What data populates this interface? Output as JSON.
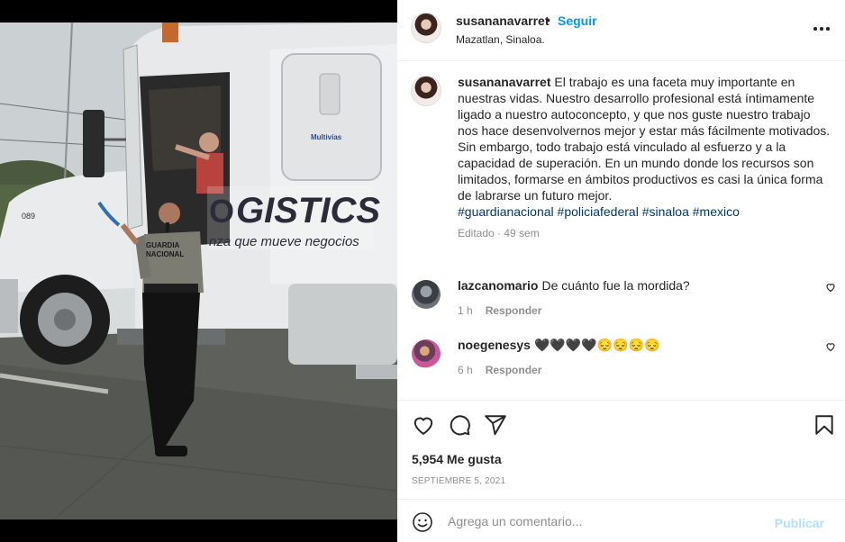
{
  "post": {
    "author": "susananavarret",
    "dot": "•",
    "follow_label": "Seguir",
    "location": "Mazatlan, Sinaloa.",
    "photo_alt": "Oficial de la Guardia Nacional junto a un camión de carga"
  },
  "photo_texts": {
    "logo_line1": "Multivías",
    "logistics": "GISTICS",
    "logistics_prefix": "O",
    "slogan": "nza que mueve negocios",
    "patch_line1": "GUARDIA",
    "patch_line2": "NACIONAL",
    "truck_number": "089"
  },
  "caption": {
    "username": "susananavarret",
    "paragraph1": "El trabajo es una faceta muy importante en nuestras vidas. Nuestro desarrollo profesional está íntimamente ligado a nuestro autoconcepto, y que nos guste nuestro trabajo nos hace desenvolvernos mejor y estar más fácilmente motivados.",
    "paragraph2": "Sin embargo, todo trabajo está vinculado al esfuerzo y a la capacidad de superación. En un mundo donde los recursos son limitados, formarse en ámbitos productivos es casi la única forma de labrarse un futuro mejor.",
    "hashtags": [
      "#guardianacional",
      "#policiafederal",
      "#sinaloa",
      "#mexico"
    ],
    "meta": "Editado · 49 sem"
  },
  "comments": [
    {
      "username": "lazcanomario",
      "text": "De cuánto fue la mordida?",
      "time": "1 h",
      "reply_label": "Responder",
      "like_icon": "heart-outline-icon"
    },
    {
      "username": "noegenesys",
      "text": "🖤🖤🖤🖤😔😔😔😔",
      "time": "6 h",
      "reply_label": "Responder",
      "like_icon": "heart-outline-icon"
    }
  ],
  "actions": {
    "icons": [
      "heart-icon",
      "comment-icon",
      "share-icon",
      "bookmark-icon"
    ],
    "likes": "5,954 Me gusta",
    "date": "Septiembre 5, 2021"
  },
  "add_comment": {
    "placeholder": "Agrega un comentario...",
    "post_label": "Publicar",
    "emoji_icon": "smiley-icon"
  },
  "colors": {
    "accent": "#0095f6",
    "hashtag": "#00376b",
    "muted": "#8e8e8e",
    "post_disabled": "#b2dffc"
  }
}
